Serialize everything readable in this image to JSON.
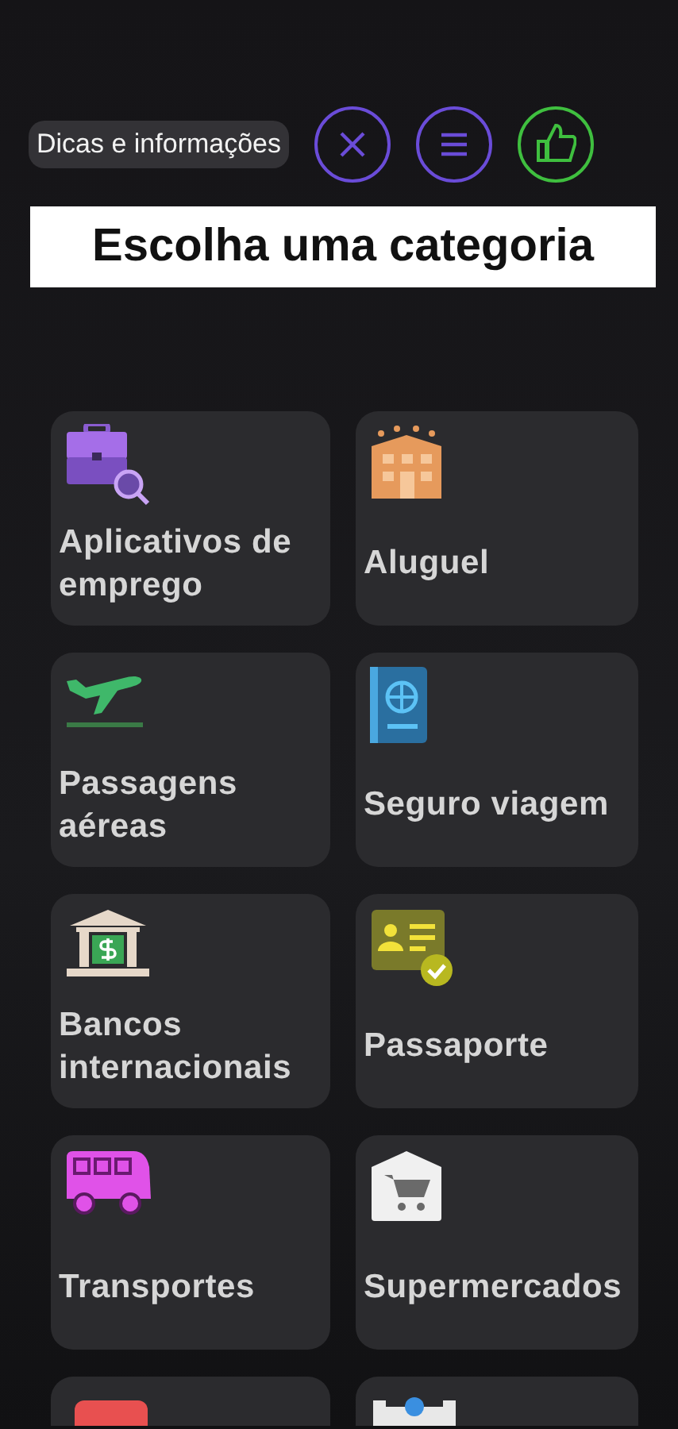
{
  "header": {
    "tip_label": "Dicas e informações",
    "buttons": [
      {
        "kind": "close"
      },
      {
        "kind": "menu"
      },
      {
        "kind": "like"
      }
    ]
  },
  "title": "Escolha uma categoria",
  "categories": [
    {
      "label": "Aplicativos de emprego"
    },
    {
      "label": "Aluguel"
    },
    {
      "label": "Passagens aéreas"
    },
    {
      "label": "Seguro viagem"
    },
    {
      "label": "Bancos internacionais"
    },
    {
      "label": "Passaporte"
    },
    {
      "label": "Transportes"
    },
    {
      "label": "Supermercados"
    }
  ]
}
